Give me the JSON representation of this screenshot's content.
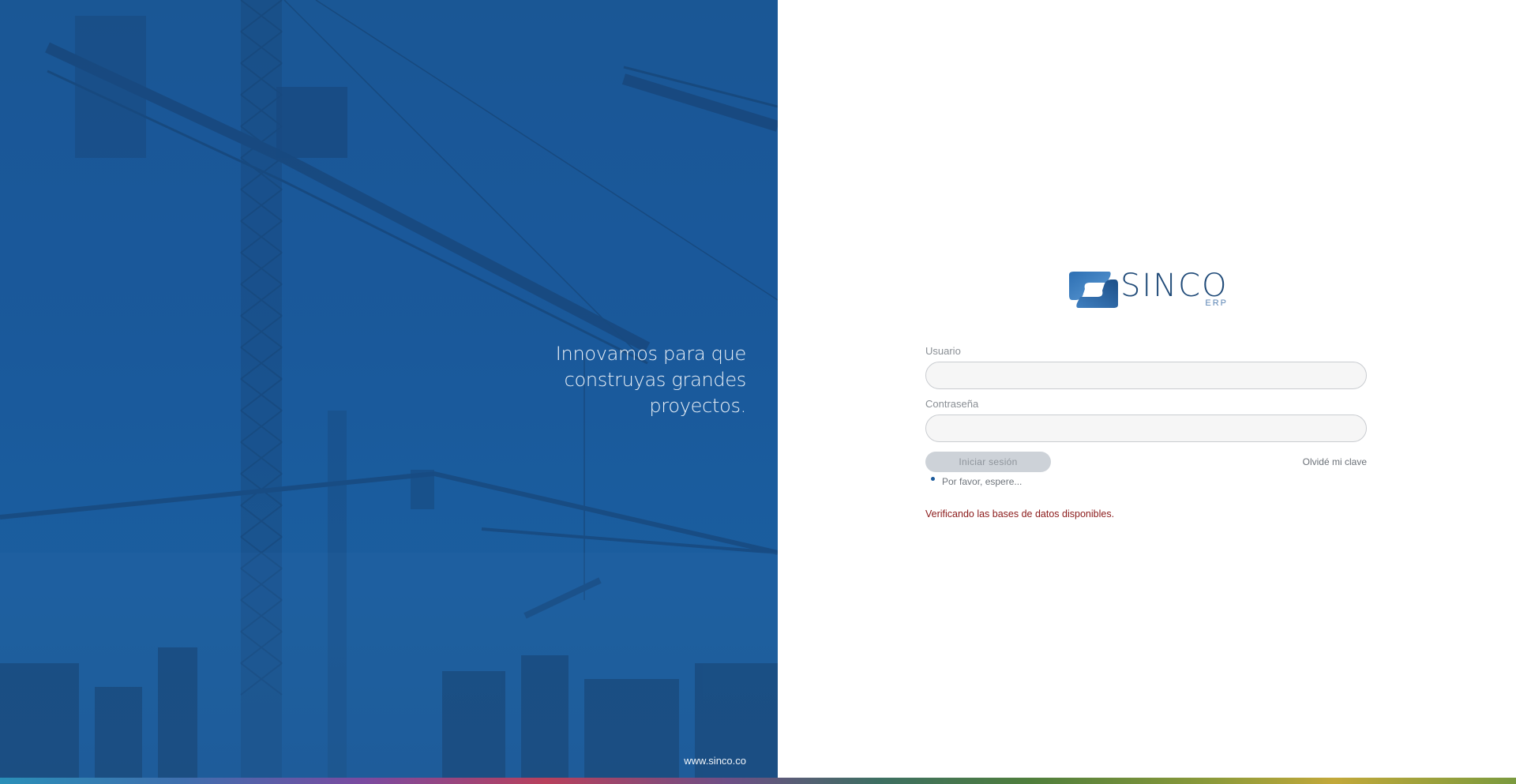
{
  "hero": {
    "tagline": [
      "Innovamos para que",
      "construyas grandes",
      "proyectos."
    ],
    "url": "www.sinco.co"
  },
  "brand": {
    "name": "SINCO",
    "sub": "ERP",
    "primary_color": "#1b5a9b",
    "logo_dark": "#1f4a78",
    "logo_light": "#5c86b5"
  },
  "form": {
    "user_label": "Usuario",
    "user_value": "",
    "password_label": "Contraseña",
    "password_value": "",
    "login_button": "Iniciar sesión",
    "forgot_link": "Olvidé mi clave",
    "wait_text": "Por favor, espere...",
    "status_message": "Verificando las bases de datos disponibles.",
    "status_color": "#8b1a1a"
  }
}
